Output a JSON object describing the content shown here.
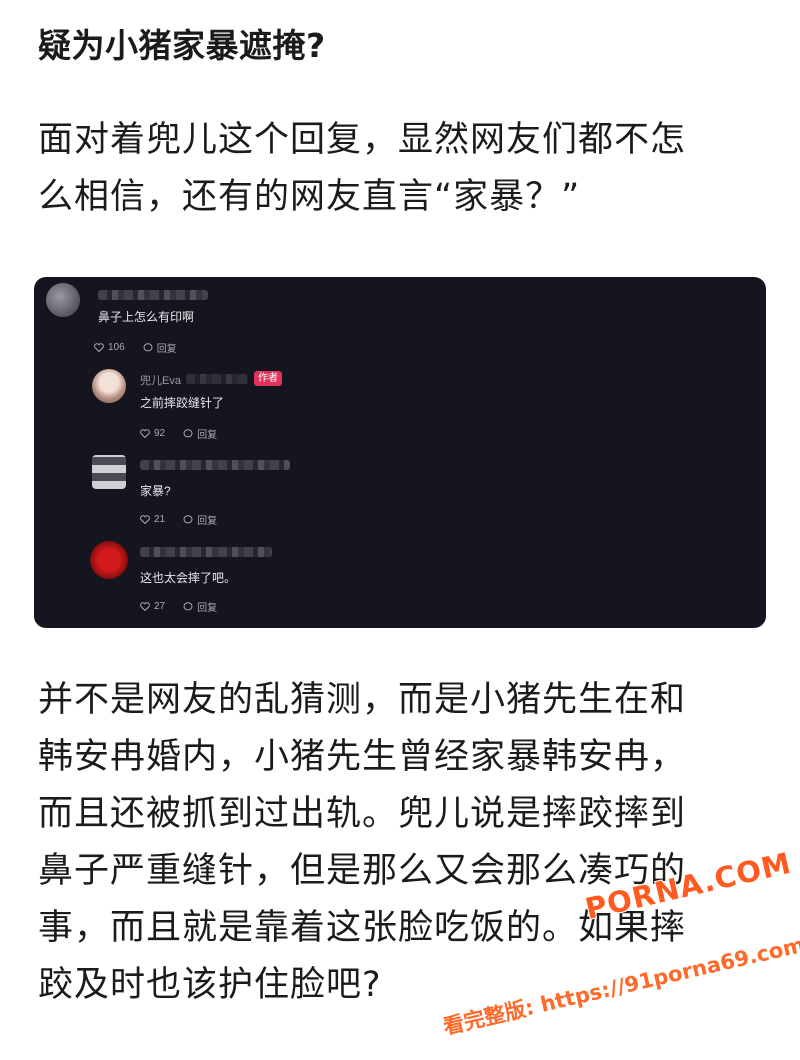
{
  "article": {
    "heading": "疑为小猪家暴遮掩?",
    "para1_lines": [
      "面对着兜儿这个回复，显然网友们都不怎",
      "么相信，还有的网友直言“家暴？”"
    ],
    "para2_lines": [
      "并不是网友的乱猜测，而是小猪先生在和",
      "韩安冉婚内，小猪先生曾经家暴韩安冉，",
      "而且还被抓到过出轨。兜儿说是摔跤摔到",
      "鼻子严重缝针，但是那么又会那么凑巧的",
      "事，而且就是靠着这张脸吃饭的。如果摔",
      "跤及时也该护住脸吧?"
    ]
  },
  "comments": [
    {
      "name": "",
      "badge": "",
      "text": "鼻子上怎么有印啊",
      "likes": "106",
      "reply_label": "回复"
    },
    {
      "name": "兜儿Eva",
      "badge": "作者",
      "text": "之前摔跤缝针了",
      "likes": "92",
      "reply_label": "回复"
    },
    {
      "name": "",
      "badge": "",
      "text": "家暴?",
      "likes": "21",
      "reply_label": "回复"
    },
    {
      "name": "",
      "badge": "",
      "text": "这也太会摔了吧。",
      "likes": "27",
      "reply_label": "回复"
    }
  ],
  "watermark": {
    "logo": "PORNA.COM",
    "line": "看完整版: https://91porna69.com"
  },
  "colors": {
    "comment_bg": "#15151f",
    "author_badge": "#e0325b",
    "watermark": "#ff5a1f"
  }
}
